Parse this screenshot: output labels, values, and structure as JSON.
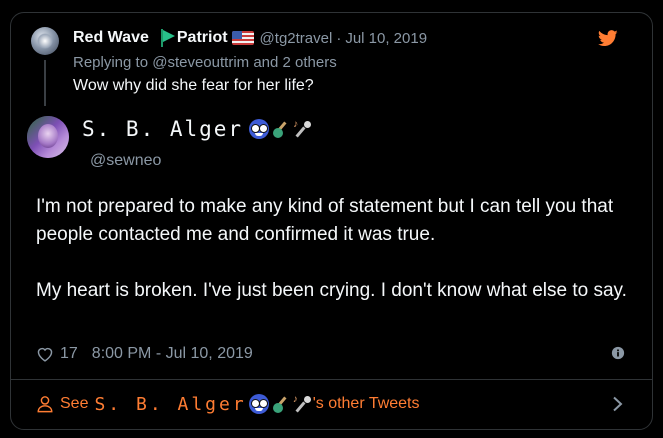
{
  "parent_tweet": {
    "author_name": "Red Wave",
    "author_label": "Patriot",
    "handle": "@tg2travel",
    "separator": "·",
    "date": "Jul 10, 2019",
    "replying_prefix": "Replying to",
    "replying_mention": "@steveouttrim",
    "replying_suffix": "and 2 others",
    "text": "Wow why did she fear for her life?"
  },
  "main_tweet": {
    "display_name": "S. B. Alger",
    "handle": "@sewneo",
    "paragraphs": [
      "I'm not prepared to make any kind of statement but I can tell you that people contacted me and confirmed it was true.",
      "My heart is broken. I've just been crying. I don't know what else to say."
    ],
    "like_count": "17",
    "timestamp": "8:00 PM - Jul 10, 2019"
  },
  "footer": {
    "prefix": "See",
    "name": "S. B. Alger",
    "suffix": "'s other Tweets"
  },
  "colors": {
    "background": "#000000",
    "text_primary": "#f5f8fa",
    "text_secondary": "#8b98a5",
    "accent": "#ff7d33",
    "border": "#2f3336"
  },
  "icons": [
    "twitter-bird-icon",
    "heart-icon",
    "info-icon",
    "person-icon",
    "chevron-right-icon",
    "flag-icon",
    "us-flag-icon",
    "nerd-face-icon",
    "guitar-icon",
    "microphone-icon"
  ]
}
